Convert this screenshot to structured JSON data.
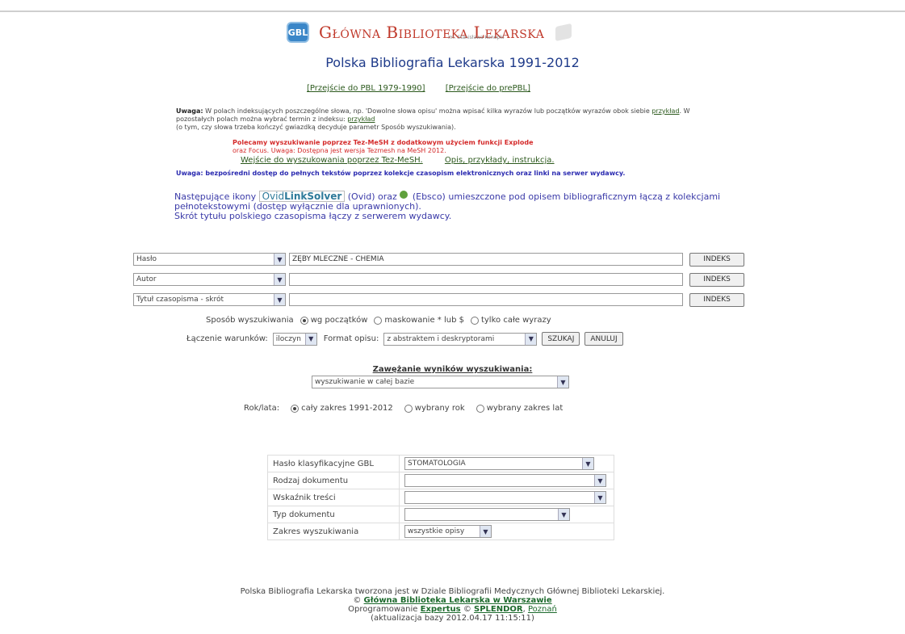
{
  "header": {
    "logo_text": "Główna Biblioteka Lekarska",
    "logo_icon_text": "GBL",
    "logo_sub": "im. Stanisława Konopki",
    "title": "Polska Bibliografia Lekarska 1991-2012"
  },
  "links": {
    "pbl_old": "[Przejście do PBL 1979-1990]",
    "prepbl": "[Przejście do prePBL]"
  },
  "notes": {
    "uwaga1_label": "Uwaga:",
    "uwaga1_text_a": "W polach indeksujących poszczególne słowa, np. 'Dowolne słowa opisu' można wpisać kilka wyrazów lub początków wyrazów obok siebie",
    "uwaga1_link_a": "przykład",
    "uwaga1_text_b": ". W pozostałych polach można wybrać termin z indeksu:",
    "uwaga1_link_b": "przykład",
    "uwaga1_text_c": "(o tym, czy słowa trzeba kończyć gwiazdką decyduje parametr Sposób wyszukiwania).",
    "polecamy_1": "Polecamy wyszukiwanie poprzez Tez-MeSH z dodatkowym użyciem funkcji Explode",
    "polecamy_2": "oraz Focus.    Uwaga: Dostępna jest wersja Tezmesh na MeSH 2012.",
    "tez_link": "Wejście do wyszukowania poprzez Tez-MeSH.",
    "opis_link": "Opis, przykłady, instrukcja.",
    "uwaga2": "Uwaga: bezpośredni dostęp do pełnych tekstów poprzez kolekcje czasopism elektronicznych oraz linki na serwer wydawcy.",
    "icons_a": "Następujące ikony",
    "ovid_label": "Ovid",
    "linksolver_label": "LinkSolver",
    "icons_b": "(Ovid) oraz",
    "icons_c": "(Ebsco) umieszczone pod opisem bibliograficznym łączą z kolekcjami pełnotekstowymi (dostęp wyłącznie dla uprawnionych).",
    "icons_d": "Skrót tytułu polskiego czasopisma łączy z serwerem wydawcy."
  },
  "search_rows": [
    {
      "field": "Hasło",
      "value": "ZĘBY MLECZNE - CHEMIA",
      "button": "INDEKS"
    },
    {
      "field": "Autor",
      "value": "",
      "button": "INDEKS"
    },
    {
      "field": "Tytuł czasopisma - skrót",
      "value": "",
      "button": "INDEKS"
    }
  ],
  "mode": {
    "label": "Sposób wyszukiwania",
    "opt1": "wg początków",
    "opt2": "maskowanie * lub $",
    "opt3": "tylko całe wyrazy",
    "selected": "wg początków"
  },
  "combine": {
    "label": "Łączenie warunków:",
    "value": "iloczyn",
    "format_label": "Format opisu:",
    "format_value": "z abstraktem i deskryptorami",
    "search_button": "SZUKAJ",
    "cancel_button": "ANULUJ"
  },
  "narrow": {
    "title": "Zawężanie wyników wyszukiwania:",
    "value": "wyszukiwanie w całej bazie"
  },
  "years": {
    "label": "Rok/lata:",
    "opt1": "cały zakres 1991-2012",
    "opt2": "wybrany rok",
    "opt3": "wybrany zakres lat",
    "selected": "cały zakres 1991-2012"
  },
  "filters": [
    {
      "label": "Hasło klasyfikacyjne GBL",
      "value": "STOMATOLOGIA"
    },
    {
      "label": "Rodzaj dokumentu",
      "value": ""
    },
    {
      "label": "Wskaźnik treści",
      "value": ""
    },
    {
      "label": "Typ dokumentu",
      "value": ""
    },
    {
      "label": "Zakres wyszukiwania",
      "value": "wszystkie opisy"
    }
  ],
  "footer": {
    "line1": "Polska Bibliografia Lekarska tworzona jest w Dziale Bibliografii Medycznych Głównej Biblioteki Lekarskiej.",
    "copy_prefix": "©",
    "copy_link": "Główna Biblioteka Lekarska w Warszawie",
    "prog_prefix": "Oprogramowanie",
    "expertus": "Expertus",
    "prog_mid": "©",
    "splendor": "SPLENDOR",
    "poznan": "Poznań",
    "update": "(aktualizacja bazy 2012.04.17 11:15:11)"
  },
  "colors": {
    "logo_red": "#c0392b",
    "title_blue": "#1f3b8a",
    "link_green": "#2d5a1e",
    "warning_red": "#d42a2a",
    "note_blue": "#2a2ab0"
  }
}
